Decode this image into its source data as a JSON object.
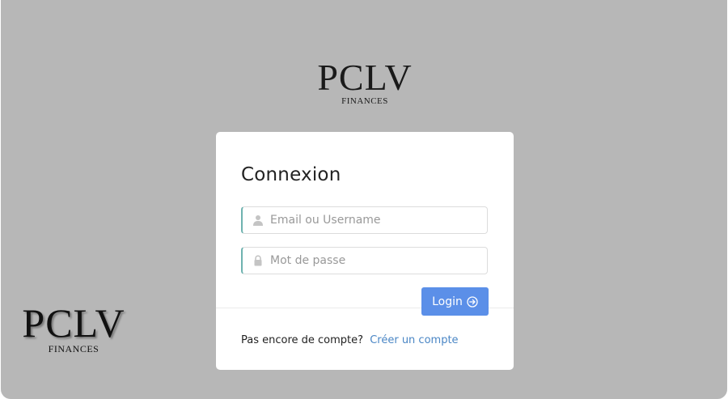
{
  "logo": {
    "mark": "PCLV",
    "sub": "FINANCES"
  },
  "login": {
    "title": "Connexion",
    "username_placeholder": "Email ou Username",
    "username_value": "",
    "password_placeholder": "Mot de passe",
    "password_value": "",
    "button_label": "Login",
    "no_account_text": "Pas encore de compte?",
    "create_account_link": "Créer un compte"
  },
  "icons": {
    "username": "user-icon",
    "password": "lock-icon",
    "login": "arrow-circle-right-icon"
  },
  "colors": {
    "background": "#b7b7b7",
    "primary_button": "#5b8fe8",
    "link": "#4a86c5",
    "field_accent": "#6fb3b0"
  }
}
